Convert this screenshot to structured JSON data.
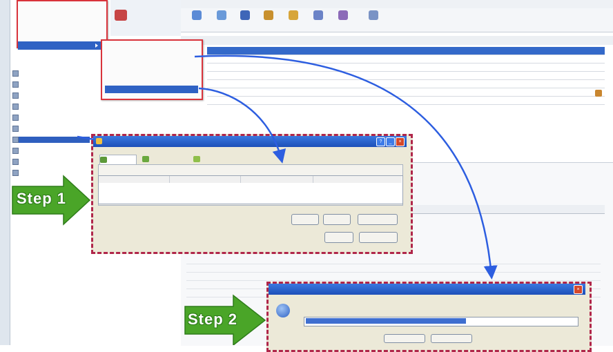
{
  "annotations": {
    "step1": "Step 1",
    "step2": "Step 2"
  },
  "colors": {
    "accent_blue": "#2f62c4",
    "highlight_red": "#d9333b",
    "arrow_green": "#4aa528",
    "connector_blue": "#2d5ee0"
  },
  "dialog1": {
    "title": "",
    "tabs": [
      "",
      "",
      ""
    ],
    "buttons": [
      "",
      "",
      "",
      "",
      ""
    ]
  },
  "dialog2": {
    "title": ""
  }
}
